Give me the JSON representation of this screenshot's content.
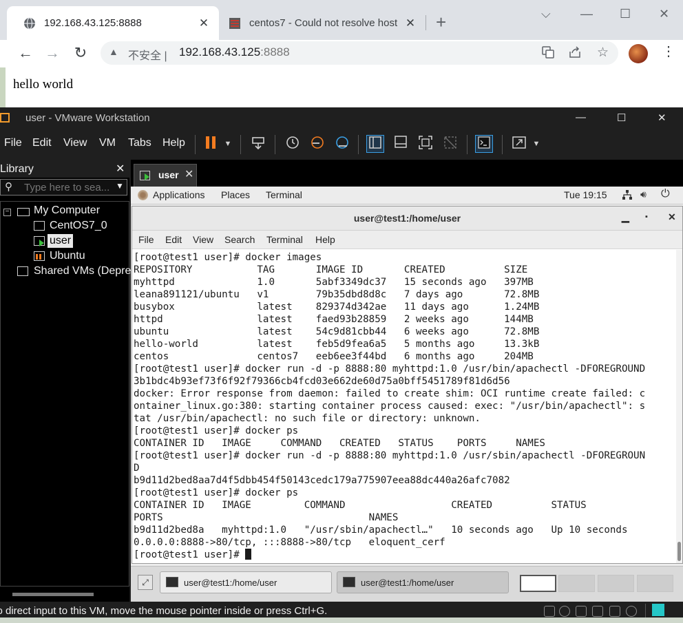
{
  "browser": {
    "tabs": [
      {
        "title": "192.168.43.125:8888",
        "active": true
      },
      {
        "title": "centos7 - Could not resolve host",
        "active": false
      }
    ],
    "new_tab": "+",
    "controls": {
      "minimize": "—",
      "maximize": "☐",
      "close": "✕",
      "tab_list": "⌵"
    },
    "nav": {
      "back": "←",
      "forward": "→",
      "reload": "↻"
    },
    "omnibox": {
      "security_label": "不安全",
      "separator": "|",
      "host": "192.168.43.125",
      "port": ":8888"
    },
    "page_text": "hello world"
  },
  "vmware": {
    "title": "user - VMware Workstation",
    "menu": [
      "File",
      "Edit",
      "View",
      "VM",
      "Tabs",
      "Help"
    ],
    "library": {
      "title": "Library",
      "search_placeholder": "Type here to sea...",
      "tree": [
        {
          "label": "My Computer",
          "level": 0
        },
        {
          "label": "CentOS7_0",
          "level": 1
        },
        {
          "label": "user",
          "level": 1,
          "selected": true
        },
        {
          "label": "Ubuntu",
          "level": 1
        },
        {
          "label": "Shared VMs (Deprecated)",
          "level": 0
        }
      ]
    },
    "vm_tab": "user",
    "status_text": "To direct input to this VM, move the mouse pointer inside or press Ctrl+G."
  },
  "guest": {
    "topbar": {
      "applications": "Applications",
      "places": "Places",
      "terminal": "Terminal",
      "clock": "Tue 19:15"
    },
    "terminal_window": {
      "title": "user@test1:/home/user",
      "menu": [
        "File",
        "Edit",
        "View",
        "Search",
        "Terminal",
        "Help"
      ],
      "lines": [
        "[root@test1 user]# docker images",
        "REPOSITORY           TAG       IMAGE ID       CREATED          SIZE",
        "myhttpd              1.0       5abf3349dc37   15 seconds ago   397MB",
        "leana891121/ubuntu   v1        79b35dbd8d8c   7 days ago       72.8MB",
        "busybox              latest    829374d342ae   11 days ago      1.24MB",
        "httpd                latest    faed93b28859   2 weeks ago      144MB",
        "ubuntu               latest    54c9d81cbb44   6 weeks ago      72.8MB",
        "hello-world          latest    feb5d9fea6a5   5 months ago     13.3kB",
        "centos               centos7   eeb6ee3f44bd   6 months ago     204MB",
        "[root@test1 user]# docker run -d -p 8888:80 myhttpd:1.0 /usr/bin/apachectl -DFOREGROUND",
        "3b1bdc4b93ef73f6f92f79366cb4fcd03e662de60d75a0bff5451789f81d6d56",
        "docker: Error response from daemon: failed to create shim: OCI runtime create failed: c",
        "ontainer_linux.go:380: starting container process caused: exec: \"/usr/bin/apachectl\": s",
        "tat /usr/bin/apachectl: no such file or directory: unknown.",
        "[root@test1 user]# docker ps",
        "CONTAINER ID   IMAGE     COMMAND   CREATED   STATUS    PORTS     NAMES",
        "[root@test1 user]# docker run -d -p 8888:80 myhttpd:1.0 /usr/sbin/apachectl -DFOREGROUN",
        "D",
        "b9d11d2bed8aa7d4f5dbb454f50143cedc179a775907eea88dc440a26afc7082",
        "[root@test1 user]# docker ps",
        "CONTAINER ID   IMAGE         COMMAND                  CREATED          STATUS",
        "PORTS                                   NAMES",
        "b9d11d2bed8a   myhttpd:1.0   \"/usr/sbin/apachectl…\"   10 seconds ago   Up 10 seconds",
        "0.0.0.0:8888->80/tcp, :::8888->80/tcp   eloquent_cerf"
      ],
      "prompt": "[root@test1 user]# "
    },
    "taskbar": {
      "tasks": [
        "user@test1:/home/user",
        "user@test1:/home/user"
      ]
    }
  }
}
